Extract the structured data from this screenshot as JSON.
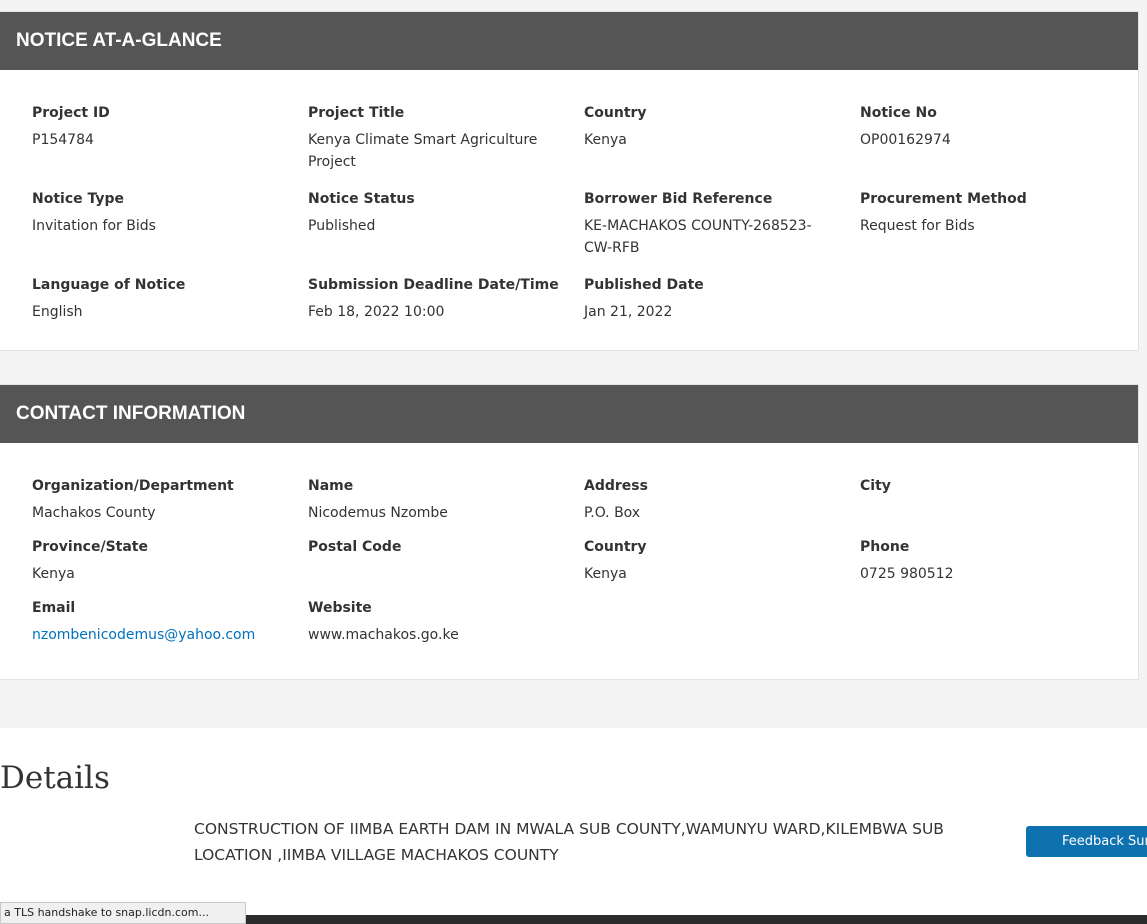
{
  "notice": {
    "header": "NOTICE AT-A-GLANCE",
    "fields": [
      {
        "label": "Project ID",
        "value": "P154784"
      },
      {
        "label": "Project Title",
        "value": "Kenya Climate Smart Agriculture Project"
      },
      {
        "label": "Country",
        "value": "Kenya"
      },
      {
        "label": "Notice No",
        "value": "OP00162974"
      },
      {
        "label": "Notice Type",
        "value": "Invitation for Bids"
      },
      {
        "label": "Notice Status",
        "value": "Published"
      },
      {
        "label": "Borrower Bid Reference",
        "value": "KE-MACHAKOS COUNTY-268523-CW-RFB"
      },
      {
        "label": "Procurement Method",
        "value": "Request for Bids"
      },
      {
        "label": "Language of Notice",
        "value": "English"
      },
      {
        "label": "Submission Deadline Date/Time",
        "value": "Feb 18, 2022 10:00"
      },
      {
        "label": "Published Date",
        "value": "Jan 21, 2022"
      }
    ]
  },
  "contact": {
    "header": "CONTACT INFORMATION",
    "fields": [
      {
        "label": "Organization/Department",
        "value": "Machakos County"
      },
      {
        "label": "Name",
        "value": "Nicodemus Nzombe"
      },
      {
        "label": "Address",
        "value": "P.O. Box"
      },
      {
        "label": "City",
        "value": ""
      },
      {
        "label": "Province/State",
        "value": "Kenya"
      },
      {
        "label": "Postal Code",
        "value": ""
      },
      {
        "label": "Country",
        "value": "Kenya"
      },
      {
        "label": "Phone",
        "value": "0725 980512"
      },
      {
        "label": "Email",
        "value": "nzombenicodemus@yahoo.com"
      },
      {
        "label": "Website",
        "value": "www.machakos.go.ke"
      }
    ]
  },
  "details": {
    "title": "Details",
    "text": "CONSTRUCTION OF IIMBA EARTH DAM IN MWALA SUB COUNTY,WAMUNYU WARD,KILEMBWA SUB LOCATION ,IIMBA VILLAGE MACHAKOS COUNTY",
    "feedback_label": "Feedback Survey"
  },
  "browser": {
    "status_text": "a TLS handshake to snap.licdn.com..."
  },
  "colors": {
    "header_bg": "#555555",
    "link": "#0071bc",
    "button": "#0f72b0"
  }
}
